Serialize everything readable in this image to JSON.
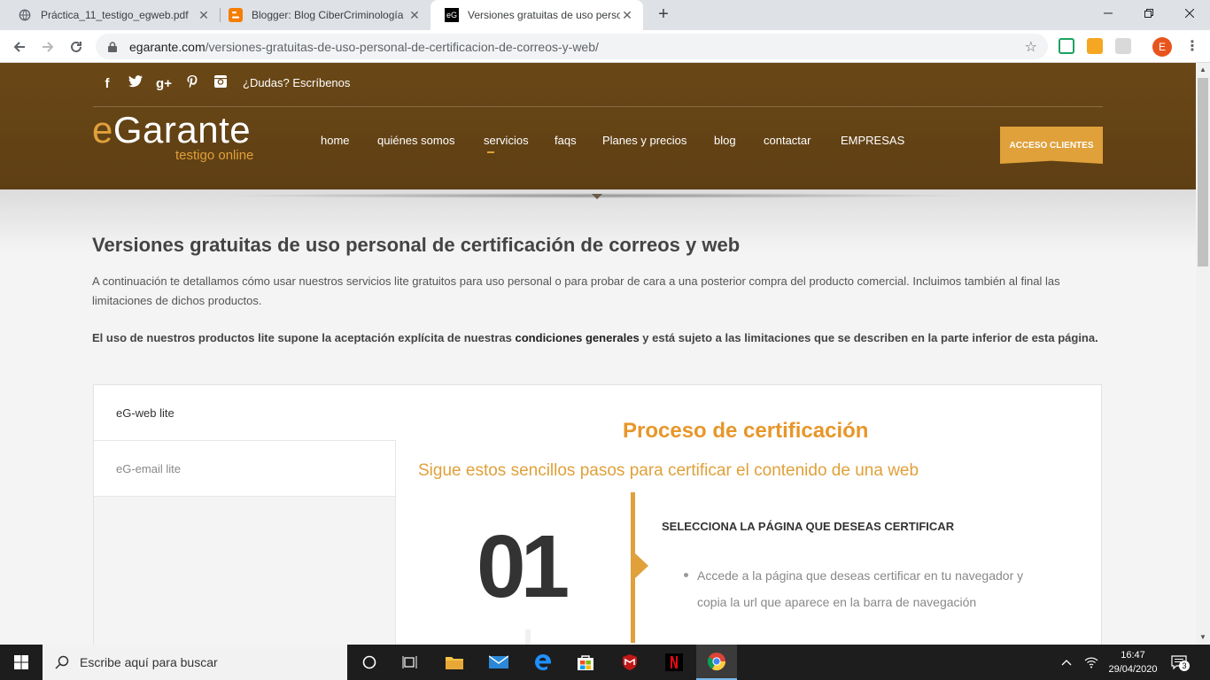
{
  "browser": {
    "tabs": [
      {
        "title": "Práctica_11_testigo_egweb.pdf",
        "favicon": "globe-icon"
      },
      {
        "title": "Blogger: Blog CiberCriminología",
        "favicon": "blogger-icon"
      },
      {
        "title": "Versiones gratuitas de uso perso",
        "favicon": "egarante-favicon"
      }
    ],
    "favicon_eg_text": "eG",
    "close_glyph": "✕",
    "new_tab_glyph": "+",
    "url_domain": "egarante.com",
    "url_path": "/versiones-gratuitas-de-uso-personal-de-certificacion-de-correos-y-web/",
    "profile_initial": "E"
  },
  "site": {
    "dudas": "¿Dudas? Escríbenos",
    "social": {
      "facebook": "f",
      "googleplus": "g+"
    },
    "logo": {
      "e": "e",
      "rest": "Garante",
      "tagline": "testigo online"
    },
    "menu": [
      {
        "label": "home",
        "current": false
      },
      {
        "label": "quiénes somos",
        "current": false
      },
      {
        "label": "servicios",
        "current": true
      },
      {
        "label": "faqs",
        "current": false
      },
      {
        "label": "Planes y precios",
        "current": false
      },
      {
        "label": "blog",
        "current": false
      },
      {
        "label": "contactar",
        "current": false
      },
      {
        "label": "EMPRESAS",
        "current": false
      }
    ],
    "cta": "ACCESO CLIENTES",
    "accent_color": "#e0a03a",
    "header_color": "#6a4716"
  },
  "page": {
    "title": "Versiones gratuitas de uso personal de certificación de correos y web",
    "intro": "A continuación te detallamos cómo usar nuestros servicios lite gratuitos para uso personal o para probar de cara a una posterior compra del producto comercial. Incluimos también al final las limitaciones de dichos productos.",
    "note_before": "El uso de nuestros productos lite supone la aceptación explícita de nuestras ",
    "note_link": "condiciones generales",
    "note_after": " y está sujeto a las limitaciones que se describen en la parte inferior de esta página.",
    "side_tabs": [
      "eG-web lite",
      "eG-email lite"
    ],
    "process_title": "Proceso de certificación",
    "process_subtitle": "Sigue estos sencillos pasos para certificar el contenido de una web",
    "step": {
      "number": "01",
      "heading": "SELECCIONA LA PÁGINA QUE DESEAS CERTIFICAR",
      "item": "Accede a la página que deseas certificar en tu navegador y copia la url que aparece en la barra de navegación"
    }
  },
  "taskbar": {
    "search_placeholder": "Escribe aquí para buscar",
    "time": "16:47",
    "date": "29/04/2020",
    "notifications": "3"
  }
}
